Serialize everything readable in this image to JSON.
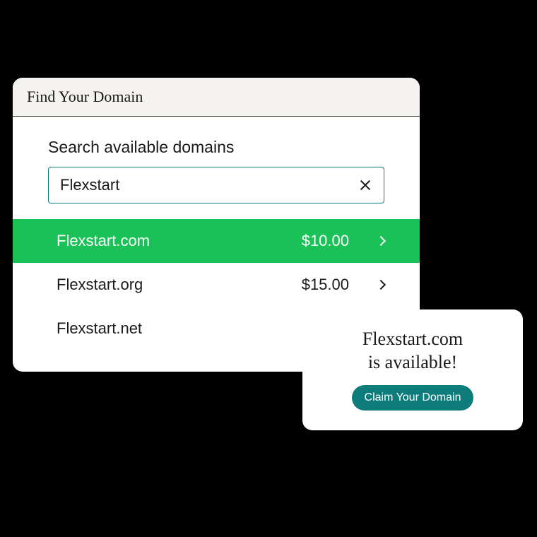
{
  "panel": {
    "title": "Find Your Domain",
    "search_label": "Search available domains",
    "search_value": "Flexstart"
  },
  "results": [
    {
      "domain": "Flexstart.com",
      "price": "$10.00",
      "highlighted": true,
      "has_chevron": true
    },
    {
      "domain": "Flexstart.org",
      "price": "$15.00",
      "highlighted": false,
      "has_chevron": true
    },
    {
      "domain": "Flexstart.net",
      "price": "",
      "highlighted": false,
      "has_chevron": false
    }
  ],
  "popup": {
    "line1": "Flexstart.com",
    "line2": "is available!",
    "button": "Claim Your Domain"
  },
  "colors": {
    "accent_green": "#19c157",
    "teal": "#0e7c7b"
  }
}
